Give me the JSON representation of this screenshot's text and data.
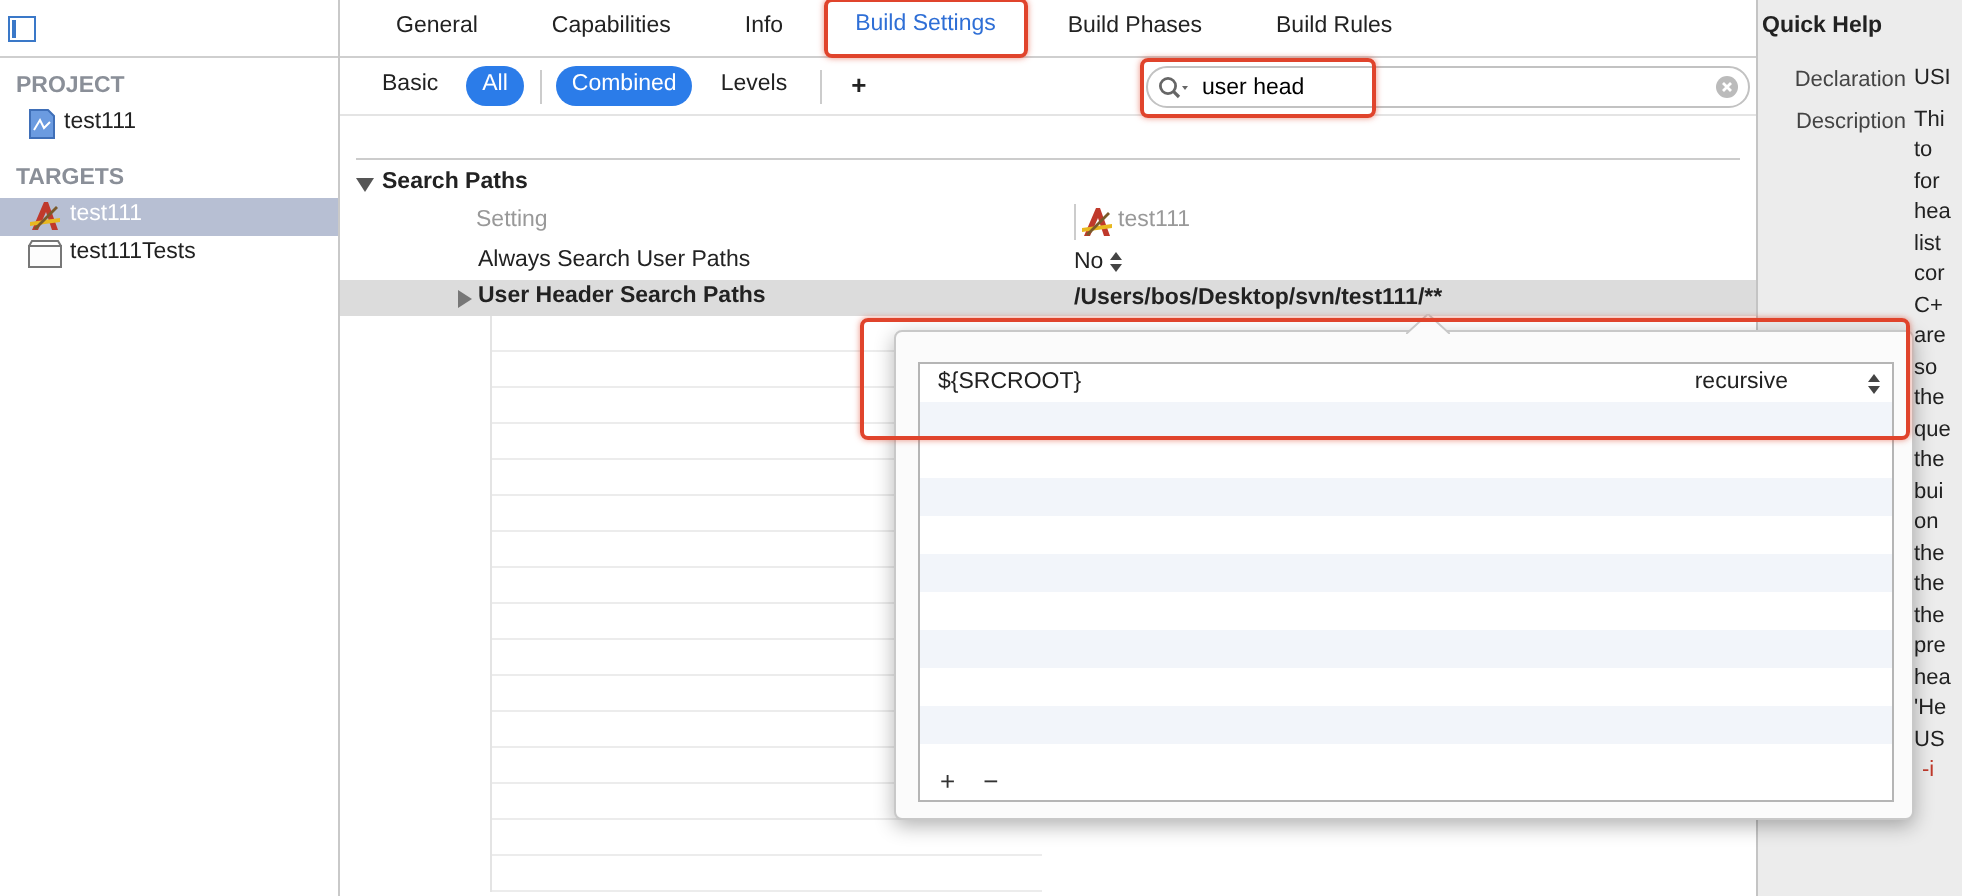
{
  "tabs": [
    {
      "label": "General",
      "selected": false,
      "highlighted": false
    },
    {
      "label": "Capabilities",
      "selected": false,
      "highlighted": false
    },
    {
      "label": "Info",
      "selected": false,
      "highlighted": false
    },
    {
      "label": "Build Settings",
      "selected": true,
      "highlighted": true
    },
    {
      "label": "Build Phases",
      "selected": false,
      "highlighted": false
    },
    {
      "label": "Build Rules",
      "selected": false,
      "highlighted": false
    }
  ],
  "sidebar": {
    "sections": [
      {
        "title": "PROJECT",
        "items": [
          {
            "label": "test111",
            "kind": "project",
            "selected": false
          }
        ]
      },
      {
        "title": "TARGETS",
        "items": [
          {
            "label": "test111",
            "kind": "app",
            "selected": true
          },
          {
            "label": "test111Tests",
            "kind": "bundle",
            "selected": false
          }
        ]
      }
    ]
  },
  "filter_bar": {
    "scopes": [
      {
        "label": "Basic",
        "selected": false
      },
      {
        "label": "All",
        "selected": true
      }
    ],
    "views": [
      {
        "label": "Combined",
        "selected": true
      },
      {
        "label": "Levels",
        "selected": false
      }
    ],
    "add_button": "+",
    "search": {
      "value": "user head",
      "highlighted": true
    }
  },
  "settings": {
    "section": {
      "title": "Search Paths",
      "expanded": true
    },
    "column_header": "Setting",
    "target_column": "test111",
    "rows": [
      {
        "name": "Always Search User Paths",
        "value": "No",
        "kind": "popup",
        "selected": false,
        "expandable": false
      },
      {
        "name": "User Header Search Paths",
        "value": "/Users/bos/Desktop/svn/test111/**",
        "kind": "text",
        "selected": true,
        "expandable": true
      }
    ]
  },
  "popover": {
    "rows": [
      {
        "path": "${SRCROOT}",
        "mode": "recursive",
        "highlighted": true
      }
    ],
    "add_button": "+",
    "remove_button": "−"
  },
  "quick_help": {
    "title": "Quick Help",
    "fields": [
      {
        "label": "Declaration",
        "lines": [
          {
            "text": "USI",
            "kind": "text"
          }
        ]
      },
      {
        "label": "Description",
        "lines": [
          {
            "text": "Thi",
            "kind": "text"
          },
          {
            "text": "to",
            "kind": "text"
          },
          {
            "text": "for",
            "kind": "text"
          },
          {
            "text": "hea",
            "kind": "text"
          },
          {
            "text": "list",
            "kind": "text"
          },
          {
            "text": "cor",
            "kind": "text"
          },
          {
            "text": "C+",
            "kind": "text"
          },
          {
            "text": "are",
            "kind": "text"
          },
          {
            "text": "so",
            "kind": "text"
          },
          {
            "text": "the",
            "kind": "text"
          },
          {
            "text": "que",
            "kind": "text"
          },
          {
            "text": "the",
            "kind": "text"
          },
          {
            "text": "bui",
            "kind": "text"
          },
          {
            "text": "on",
            "kind": "text"
          },
          {
            "text": "the",
            "kind": "text"
          },
          {
            "text": "the",
            "kind": "text"
          },
          {
            "text": "the",
            "kind": "text"
          },
          {
            "text": "pre",
            "kind": "text"
          },
          {
            "text": "hea",
            "kind": "text"
          },
          {
            "text": "'He",
            "kind": "text"
          },
          {
            "text": "US",
            "kind": "text"
          },
          {
            "text": "-i",
            "kind": "code"
          }
        ]
      }
    ]
  }
}
